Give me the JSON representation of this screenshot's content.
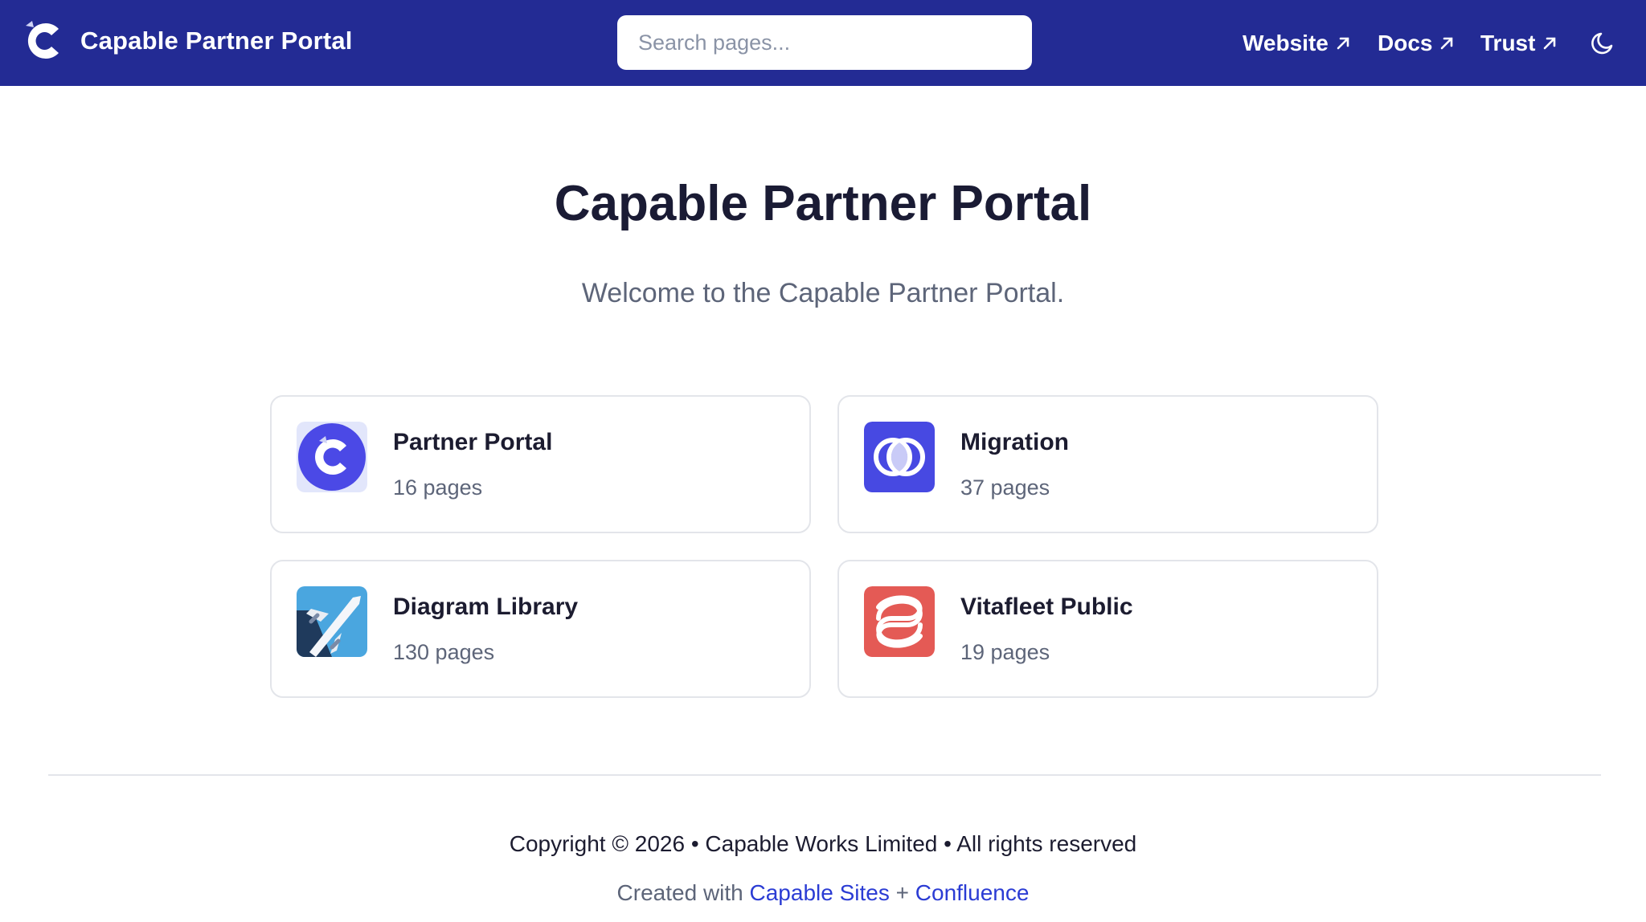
{
  "header": {
    "brand_name": "Capable Partner Portal",
    "search_placeholder": "Search pages...",
    "nav": [
      {
        "label": "Website",
        "icon": "external-link-icon"
      },
      {
        "label": "Docs",
        "icon": "external-link-icon"
      },
      {
        "label": "Trust",
        "icon": "external-link-icon"
      }
    ],
    "theme_toggle_icon": "moon-icon",
    "background_color": "#232b94"
  },
  "hero": {
    "title": "Capable Partner Portal",
    "subtitle": "Welcome to the Capable Partner Portal."
  },
  "spaces": [
    {
      "title": "Partner Portal",
      "count": "16 pages",
      "icon": "capable-logo-icon"
    },
    {
      "title": "Migration",
      "count": "37 pages",
      "icon": "overlapping-circles-icon"
    },
    {
      "title": "Diagram Library",
      "count": "130 pages",
      "icon": "airplane-icon"
    },
    {
      "title": "Vitafleet Public",
      "count": "19 pages",
      "icon": "vitafleet-logo-icon"
    }
  ],
  "footer": {
    "copyright": "Copyright © 2026 • Capable Works Limited • All rights reserved",
    "created_prefix": "Created with",
    "link1": "Capable Sites",
    "separator": "+",
    "link2": "Confluence",
    "link_color": "#2b3cd4"
  }
}
